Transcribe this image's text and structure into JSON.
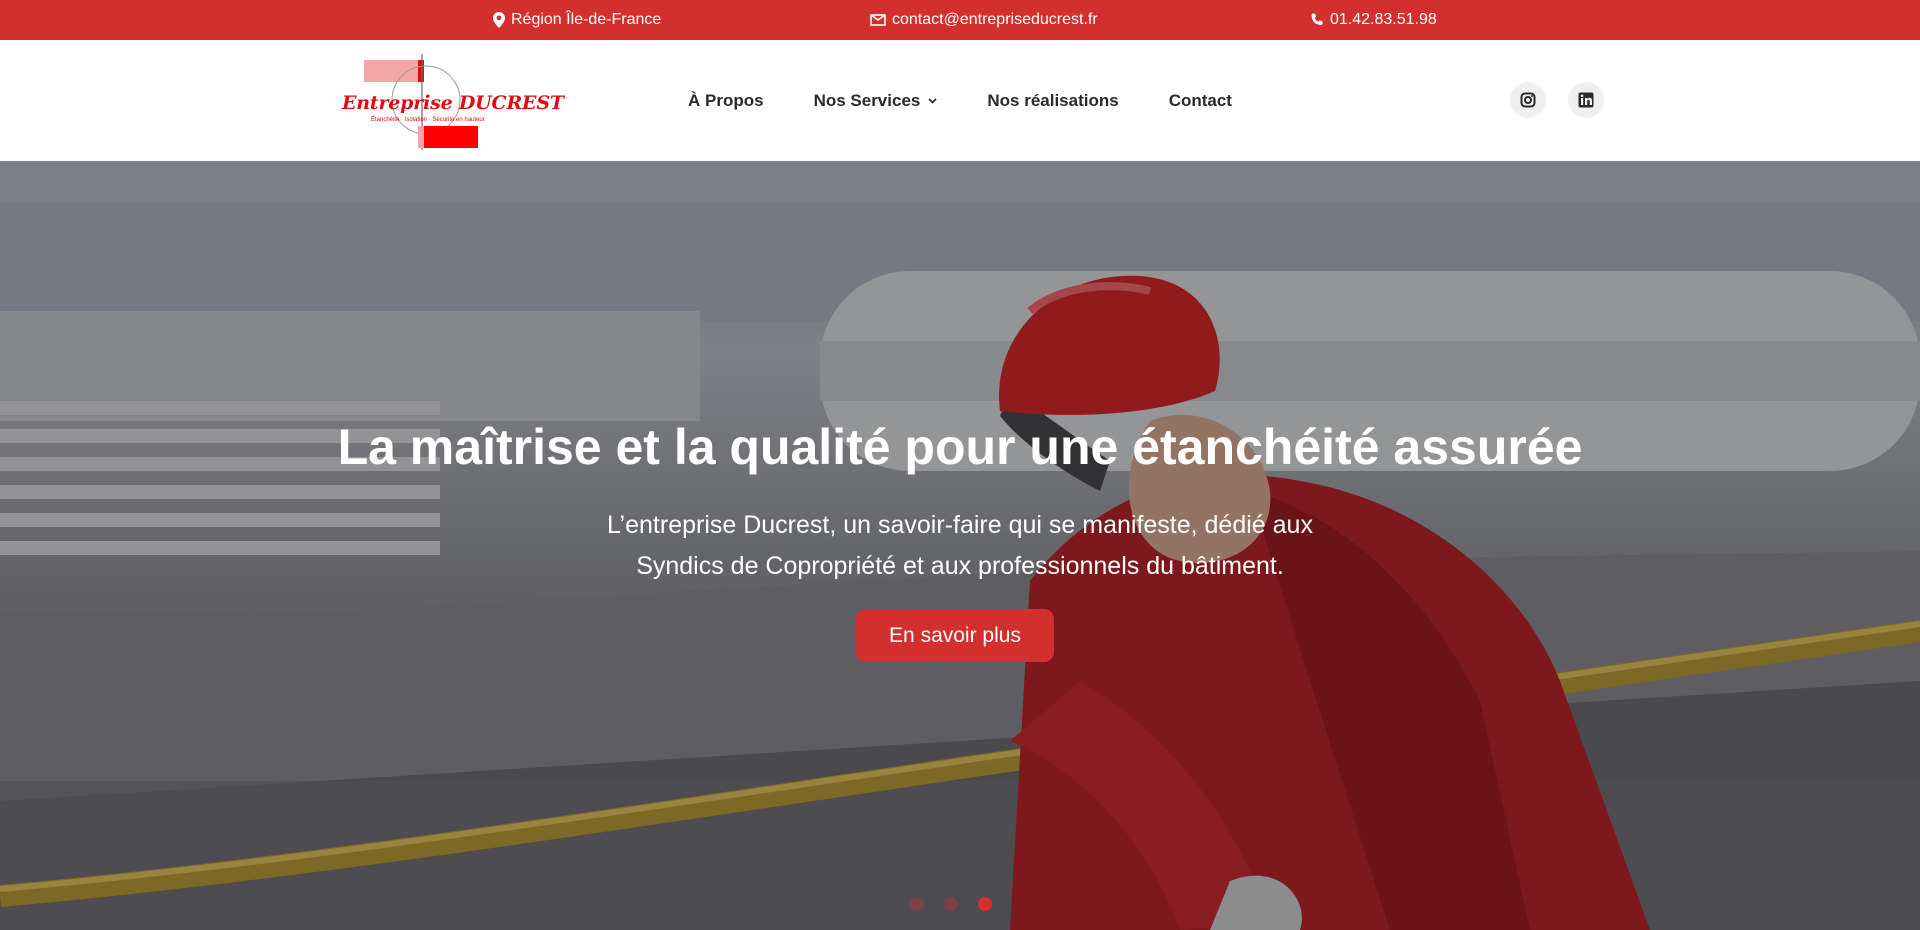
{
  "topbar": {
    "location": "Région Île-de-France",
    "email": "contact@entrepriseducrest.fr",
    "phone": "01.42.83.51.98"
  },
  "logo": {
    "word": "Entreprise DUCREST",
    "tagline": "Étanchéité · Isolation · Sécurité en hauteur"
  },
  "nav": {
    "items": [
      {
        "label": "À Propos"
      },
      {
        "label": "Nos Services",
        "has_dropdown": true
      },
      {
        "label": "Nos réalisations"
      },
      {
        "label": "Contact"
      }
    ]
  },
  "social": [
    "instagram-icon",
    "linkedin-icon"
  ],
  "hero": {
    "title": "La maîtrise et la qualité pour une étanchéité assurée",
    "subtitle_line1": "L’entreprise Ducrest, un savoir-faire qui se manifeste, dédié aux",
    "subtitle_line2": "Syndics de Copropriété et aux professionnels du bâtiment.",
    "cta": "En savoir plus",
    "slides": 3,
    "active_slide": 3
  },
  "colors": {
    "brand_red": "#d32f2f",
    "logo_red": "#e10b14"
  }
}
